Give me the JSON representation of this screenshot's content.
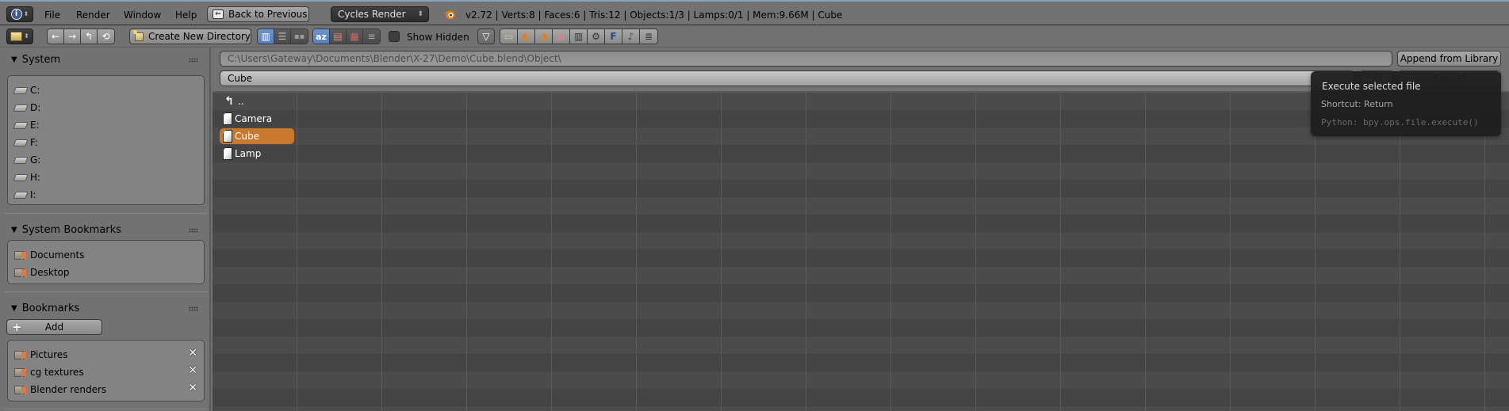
{
  "header": {
    "menus": [
      "File",
      "Render",
      "Window",
      "Help"
    ],
    "back_button": "Back to Previous",
    "render_engine": "Cycles Render",
    "stats": "v2.72 | Verts:8 | Faces:6 | Tris:12 | Objects:1/3 | Lamps:0/1 | Mem:9.66M | Cube"
  },
  "toolbar": {
    "create_dir_label": "Create New Directory",
    "show_hidden_label": "Show Hidden",
    "show_hidden_checked": false,
    "display_modes": [
      {
        "icon": "short-list-icon",
        "active": true
      },
      {
        "icon": "long-list-icon",
        "active": false
      },
      {
        "icon": "thumbnails-icon",
        "active": false
      }
    ],
    "sort_modes": [
      {
        "icon": "sort-alpha-icon",
        "glyph": "az",
        "active": true
      },
      {
        "icon": "sort-extension-icon",
        "glyph": "▤",
        "active": false
      },
      {
        "icon": "sort-time-icon",
        "glyph": "▦",
        "active": false
      },
      {
        "icon": "sort-size-icon",
        "glyph": "≡",
        "active": false
      }
    ],
    "filter_types": [
      {
        "icon": "folder-filter-icon",
        "glyph": "▭"
      },
      {
        "icon": "blend-file-filter-icon",
        "glyph": "◐"
      },
      {
        "icon": "blend-backup-filter-icon",
        "glyph": "◑"
      },
      {
        "icon": "image-filter-icon",
        "glyph": "▣"
      },
      {
        "icon": "movie-filter-icon",
        "glyph": "▥"
      },
      {
        "icon": "script-filter-icon",
        "glyph": "⚙"
      },
      {
        "icon": "font-filter-icon",
        "glyph": "F"
      },
      {
        "icon": "sound-filter-icon",
        "glyph": "♪"
      },
      {
        "icon": "text-filter-icon",
        "glyph": "≣"
      }
    ]
  },
  "sidebar": {
    "system": {
      "title": "System",
      "drives": [
        "C:",
        "D:",
        "E:",
        "F:",
        "G:",
        "H:",
        "I:"
      ]
    },
    "system_bookmarks": {
      "title": "System Bookmarks",
      "items": [
        "Documents",
        "Desktop"
      ]
    },
    "bookmarks": {
      "title": "Bookmarks",
      "add_label": "Add",
      "items": [
        "Pictures",
        "cg textures",
        "Blender renders"
      ]
    }
  },
  "main": {
    "path": "C:\\Users\\Gateway\\Documents\\Blender\\X-27\\Demo\\Cube.blend\\Object\\",
    "filename": "Cube",
    "append_button": "Append from Library",
    "cancel_button": "Cancel",
    "parent_dir": "..",
    "files": [
      {
        "name": "Camera",
        "selected": false
      },
      {
        "name": "Cube",
        "selected": true
      },
      {
        "name": "Lamp",
        "selected": false
      }
    ],
    "selected_color": "#c8792e"
  },
  "tooltip": {
    "title": "Execute selected file",
    "shortcut": "Shortcut: Return",
    "python": "Python: bpy.ops.file.execute()"
  }
}
